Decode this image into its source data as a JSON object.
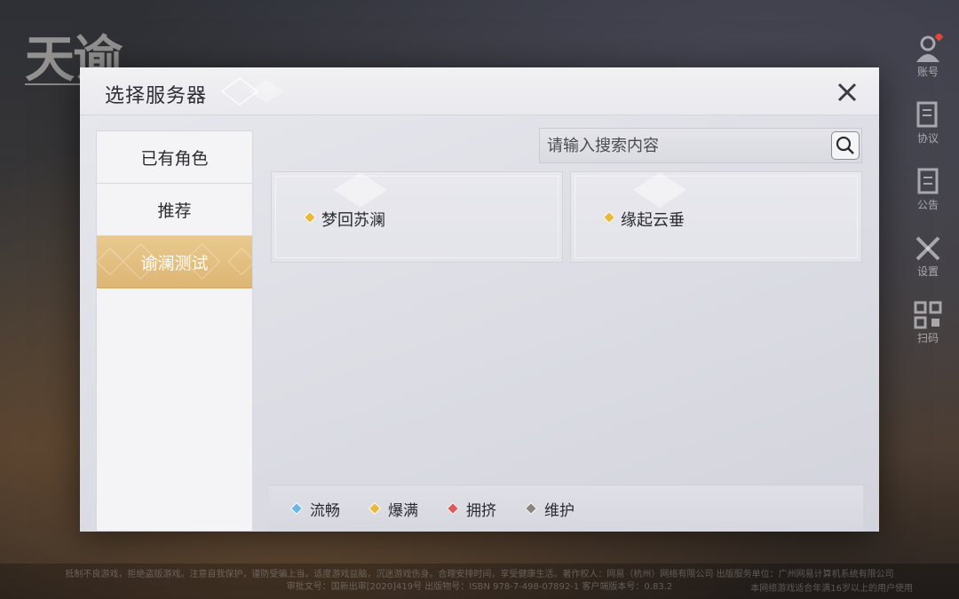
{
  "background": {
    "logo_text": "天谕",
    "side_menu": [
      {
        "label": "账号",
        "icon": "account-icon"
      },
      {
        "label": "协议",
        "icon": "agreement-icon"
      },
      {
        "label": "公告",
        "icon": "notice-icon"
      },
      {
        "label": "设置",
        "icon": "settings-icon"
      },
      {
        "label": "扫码",
        "icon": "qr-code-icon"
      }
    ],
    "footer_line1": "抵制不良游戏，拒绝盗版游戏。注意自我保护，谨防受骗上当。适度游戏益脑，沉迷游戏伤身。合理安排时间，享受健康生活。著作权人：网易（杭州）网络有限公司 出版服务单位：广州网易计算机系统有限公司",
    "footer_line2": "审批文号：国新出审[2020]419号 出版物号：ISBN 978-7-498-07892-1 客户端版本号：0.83.2",
    "footer_age": "本网络游戏适合年满16岁以上的用户使用"
  },
  "modal": {
    "title": "选择服务器",
    "close_icon": "close-icon",
    "tabs": [
      {
        "label": "已有角色",
        "active": false
      },
      {
        "label": "推荐",
        "active": false
      },
      {
        "label": "谕澜测试",
        "active": true
      }
    ],
    "search": {
      "placeholder": "请输入搜索内容",
      "value": "",
      "icon": "search-icon"
    },
    "servers": [
      {
        "name": "梦回苏澜",
        "status": "爆满",
        "status_color": "#e8b93c"
      },
      {
        "name": "缘起云垂",
        "status": "爆满",
        "status_color": "#e8b93c"
      }
    ],
    "legend": [
      {
        "label": "流畅",
        "color": "#6ab8e8"
      },
      {
        "label": "爆满",
        "color": "#e8b93c"
      },
      {
        "label": "拥挤",
        "color": "#e05a5a"
      },
      {
        "label": "维护",
        "color": "#8a8580"
      }
    ]
  }
}
